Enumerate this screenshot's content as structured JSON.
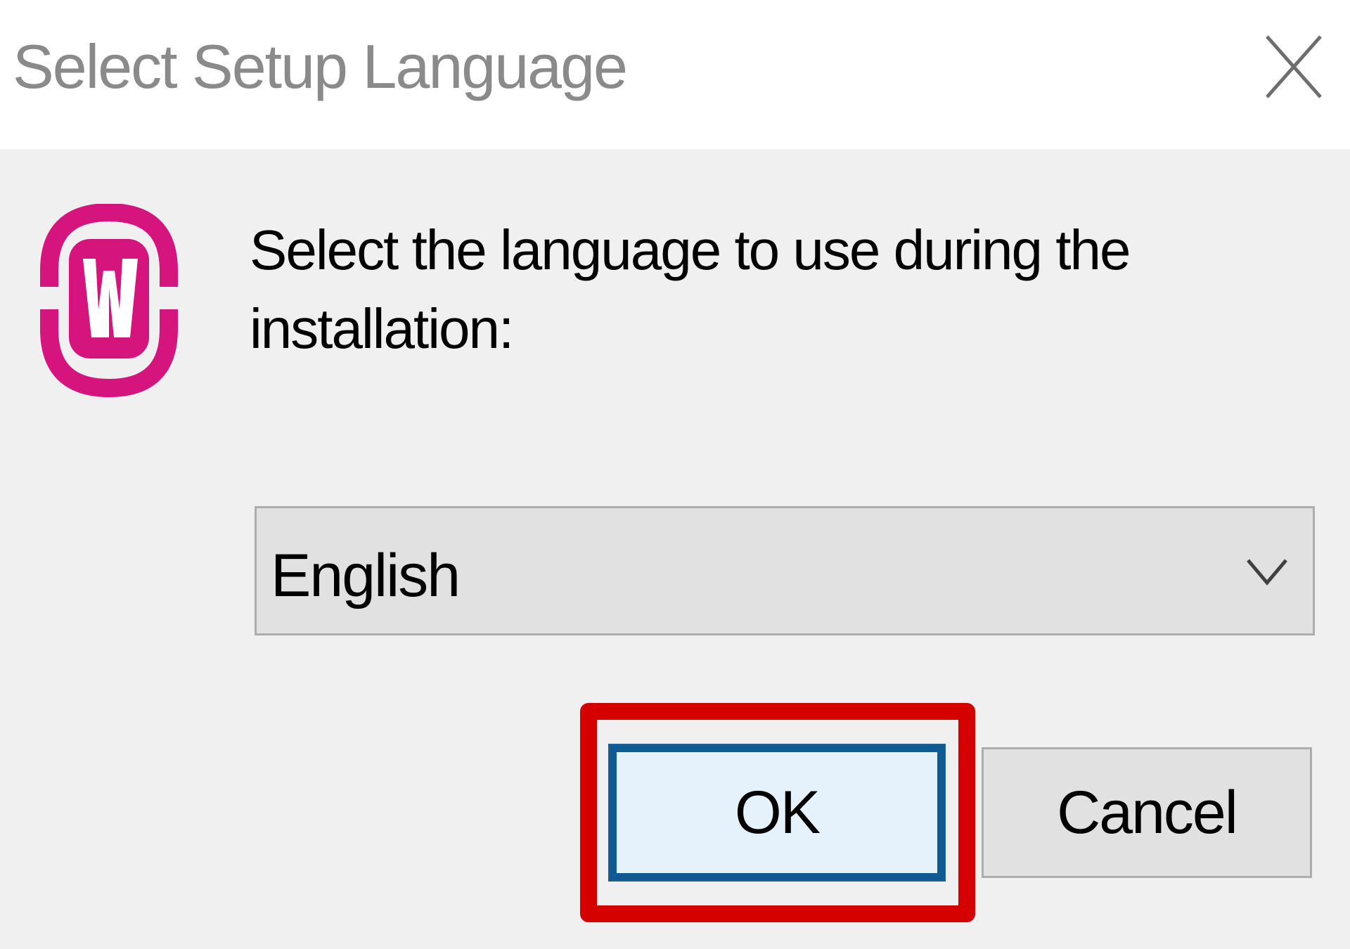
{
  "window": {
    "title": "Select Setup Language",
    "close_icon": "close-icon"
  },
  "app": {
    "icon": "wampserver-logo-icon",
    "accent_color": "#d6147e"
  },
  "main": {
    "prompt": "Select the language to use during the installation:",
    "language_select": {
      "selected": "English",
      "icon": "chevron-down-icon"
    }
  },
  "buttons": {
    "ok_label": "OK",
    "cancel_label": "Cancel"
  },
  "annotation": {
    "highlight_color": "#d50000"
  }
}
